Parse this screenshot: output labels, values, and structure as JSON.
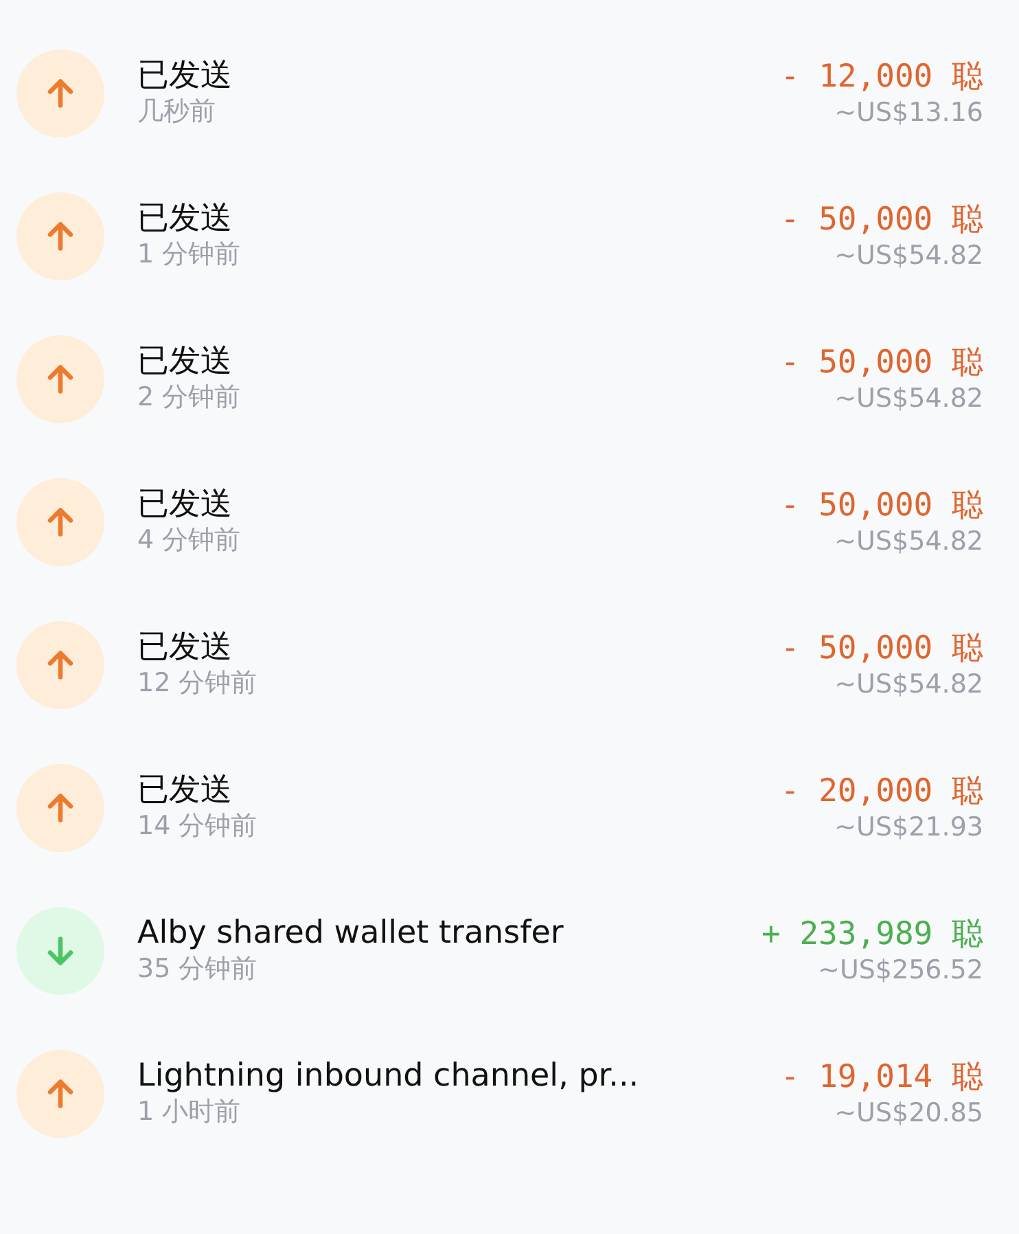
{
  "transactions": [
    {
      "kind": "sent",
      "title": "已发送",
      "time": "几秒前",
      "amount": "- 12,000 聪",
      "fiat": "~US$13.16"
    },
    {
      "kind": "sent",
      "title": "已发送",
      "time": "1 分钟前",
      "amount": "- 50,000 聪",
      "fiat": "~US$54.82"
    },
    {
      "kind": "sent",
      "title": "已发送",
      "time": "2 分钟前",
      "amount": "- 50,000 聪",
      "fiat": "~US$54.82"
    },
    {
      "kind": "sent",
      "title": "已发送",
      "time": "4 分钟前",
      "amount": "- 50,000 聪",
      "fiat": "~US$54.82"
    },
    {
      "kind": "sent",
      "title": "已发送",
      "time": "12 分钟前",
      "amount": "- 50,000 聪",
      "fiat": "~US$54.82"
    },
    {
      "kind": "sent",
      "title": "已发送",
      "time": "14 分钟前",
      "amount": "- 20,000 聪",
      "fiat": "~US$21.93"
    },
    {
      "kind": "received",
      "title": "Alby shared wallet transfer",
      "time": "35 分钟前",
      "amount": "+ 233,989 聪",
      "fiat": "~US$256.52"
    },
    {
      "kind": "sent",
      "title": "Lightning inbound channel, pr...",
      "time": "1 小时前",
      "amount": "- 19,014 聪",
      "fiat": "~US$20.85"
    }
  ]
}
